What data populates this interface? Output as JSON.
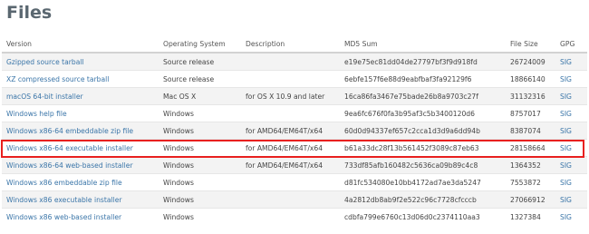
{
  "page": {
    "title": "Files"
  },
  "table": {
    "headers": {
      "version": "Version",
      "os": "Operating System",
      "description": "Description",
      "md5": "MD5 Sum",
      "size": "File Size",
      "gpg": "GPG"
    },
    "rows": [
      {
        "version": "Gzipped source tarball",
        "os": "Source release",
        "description": "",
        "md5": "e19e75ec81dd04de27797bf3f9d918fd",
        "size": "26724009",
        "gpg": "SIG"
      },
      {
        "version": "XZ compressed source tarball",
        "os": "Source release",
        "description": "",
        "md5": "6ebfe157f6e88d9eabfbaf3fa92129f6",
        "size": "18866140",
        "gpg": "SIG"
      },
      {
        "version": "macOS 64-bit installer",
        "os": "Mac OS X",
        "description": "for OS X 10.9 and later",
        "md5": "16ca86fa3467e75bade26b8a9703c27f",
        "size": "31132316",
        "gpg": "SIG"
      },
      {
        "version": "Windows help file",
        "os": "Windows",
        "description": "",
        "md5": "9ea6fc676f0fa3b95af3c5b3400120d6",
        "size": "8757017",
        "gpg": "SIG"
      },
      {
        "version": "Windows x86-64 embeddable zip file",
        "os": "Windows",
        "description": "for AMD64/EM64T/x64",
        "md5": "60d0d94337ef657c2cca1d3d9a6dd94b",
        "size": "8387074",
        "gpg": "SIG"
      },
      {
        "version": "Windows x86-64 executable installer",
        "os": "Windows",
        "description": "for AMD64/EM64T/x64",
        "md5": "b61a33dc28f13b561452f3089c87eb63",
        "size": "28158664",
        "gpg": "SIG"
      },
      {
        "version": "Windows x86-64 web-based installer",
        "os": "Windows",
        "description": "for AMD64/EM64T/x64",
        "md5": "733df85afb160482c5636ca09b89c4c8",
        "size": "1364352",
        "gpg": "SIG"
      },
      {
        "version": "Windows x86 embeddable zip file",
        "os": "Windows",
        "description": "",
        "md5": "d81fc534080e10bb4172ad7ae3da5247",
        "size": "7553872",
        "gpg": "SIG"
      },
      {
        "version": "Windows x86 executable installer",
        "os": "Windows",
        "description": "",
        "md5": "4a2812db8ab9f2e522c96c7728cfcccb",
        "size": "27066912",
        "gpg": "SIG"
      },
      {
        "version": "Windows x86 web-based installer",
        "os": "Windows",
        "description": "",
        "md5": "cdbfa799e6760c13d06d0c2374110aa3",
        "size": "1327384",
        "gpg": "SIG"
      }
    ]
  },
  "highlighted_row": "Windows x86-64 executable installer",
  "colors": {
    "title": "#5a6770",
    "link": "#3a75a8",
    "highlight_border": "#e8201f",
    "stripe": "#f3f3f3"
  }
}
